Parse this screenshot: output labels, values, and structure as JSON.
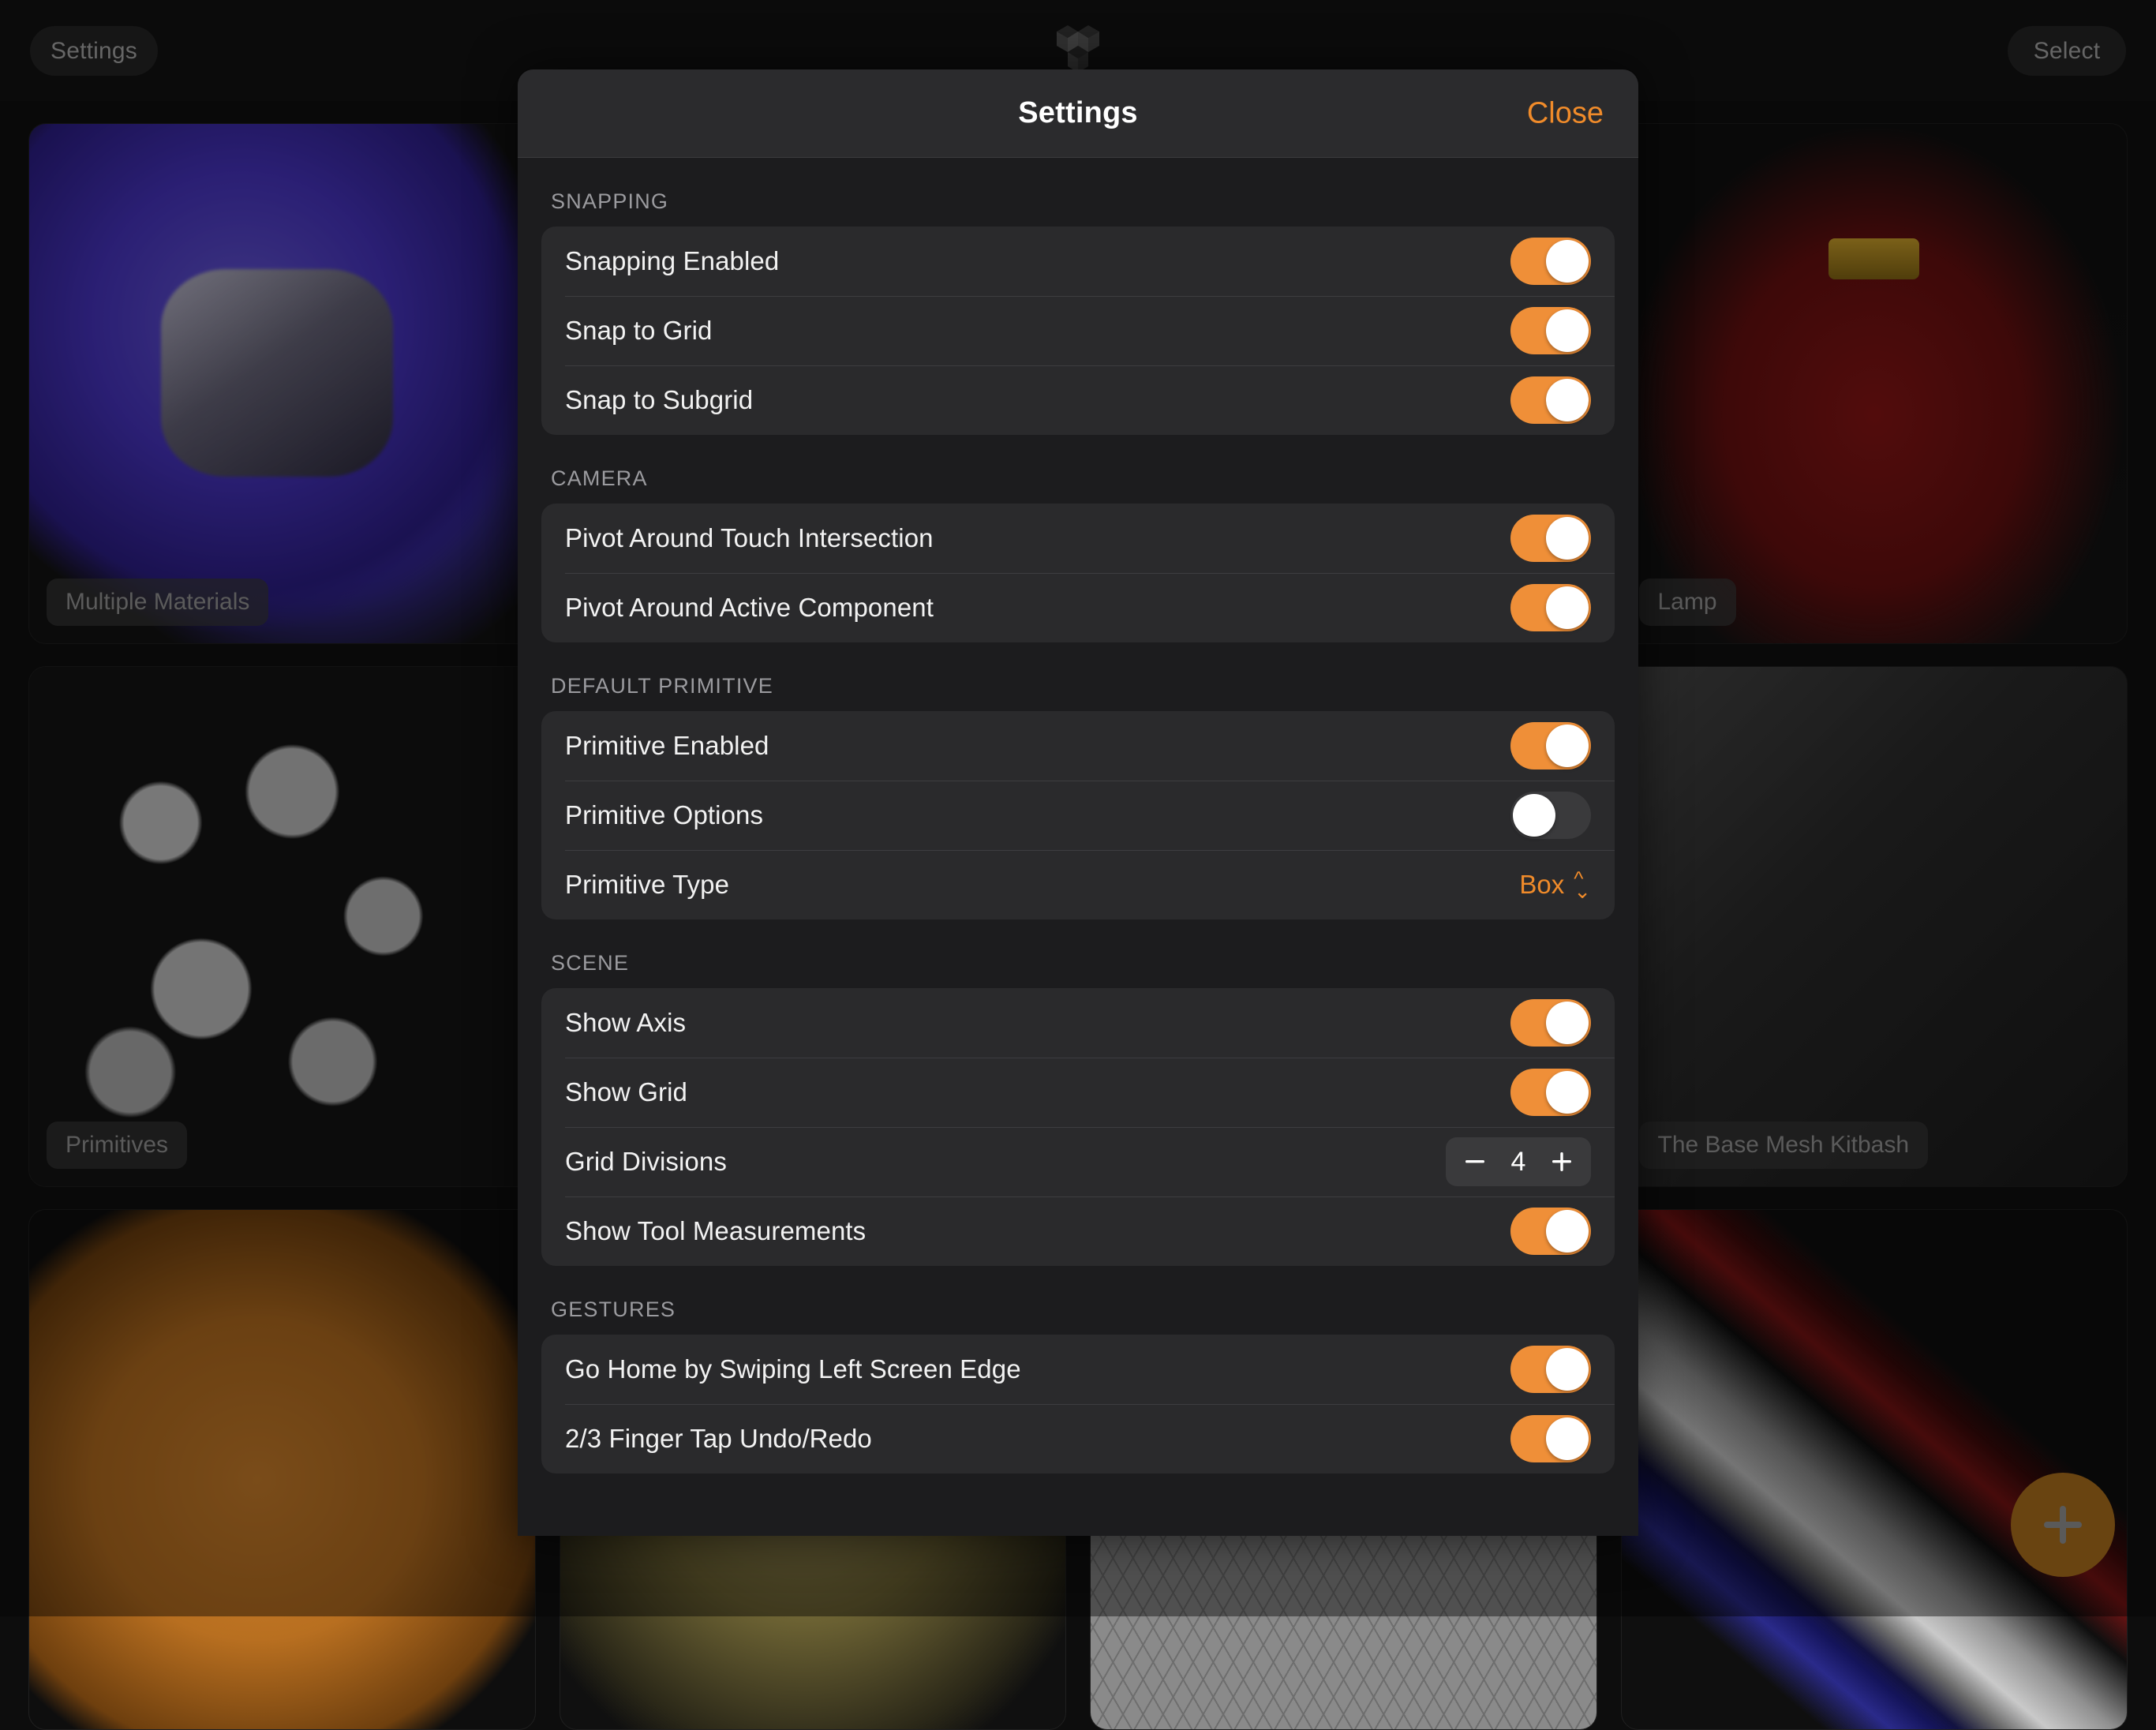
{
  "topbar": {
    "settings_label": "Settings",
    "select_label": "Select",
    "logo_name": "shapr3d-logo"
  },
  "gallery": {
    "items": [
      {
        "label": "Multiple Materials",
        "scene": "sc-multimat"
      },
      {
        "label": "",
        "scene": "sc-dark"
      },
      {
        "label": "",
        "scene": "sc-dark"
      },
      {
        "label": "Lamp",
        "scene": "sc-lamp"
      },
      {
        "label": "Primitives",
        "scene": "sc-prims"
      },
      {
        "label": "",
        "scene": "sc-dark"
      },
      {
        "label": "",
        "scene": "sc-dark"
      },
      {
        "label": "The Base Mesh Kitbash",
        "scene": "sc-kitbash"
      },
      {
        "label": "",
        "scene": "sc-blob"
      },
      {
        "label": "",
        "scene": "sc-olive"
      },
      {
        "label": "",
        "scene": "sc-wire"
      },
      {
        "label": "",
        "scene": "sc-rings"
      }
    ],
    "add_button_label": "+"
  },
  "modal": {
    "title": "Settings",
    "close_label": "Close",
    "sections": [
      {
        "title": "SNAPPING",
        "rows": [
          {
            "label": "Snapping Enabled",
            "control": "toggle",
            "value": "on"
          },
          {
            "label": "Snap to Grid",
            "control": "toggle",
            "value": "on"
          },
          {
            "label": "Snap to Subgrid",
            "control": "toggle",
            "value": "on"
          }
        ]
      },
      {
        "title": "CAMERA",
        "rows": [
          {
            "label": "Pivot Around Touch Intersection",
            "control": "toggle",
            "value": "on"
          },
          {
            "label": "Pivot Around Active Component",
            "control": "toggle",
            "value": "on"
          }
        ]
      },
      {
        "title": "DEFAULT PRIMITIVE",
        "rows": [
          {
            "label": "Primitive Enabled",
            "control": "toggle",
            "value": "on"
          },
          {
            "label": "Primitive Options",
            "control": "toggle",
            "value": "off"
          },
          {
            "label": "Primitive Type",
            "control": "picker",
            "value": "Box"
          }
        ]
      },
      {
        "title": "SCENE",
        "rows": [
          {
            "label": "Show Axis",
            "control": "toggle",
            "value": "on"
          },
          {
            "label": "Show Grid",
            "control": "toggle",
            "value": "on"
          },
          {
            "label": "Grid Divisions",
            "control": "stepper",
            "value": "4"
          },
          {
            "label": "Show Tool Measurements",
            "control": "toggle",
            "value": "on"
          }
        ]
      },
      {
        "title": "GESTURES",
        "rows": [
          {
            "label": "Go Home by Swiping Left Screen Edge",
            "control": "toggle",
            "value": "on"
          },
          {
            "label": "2/3 Finger Tap Undo/Redo",
            "control": "toggle",
            "value": "on"
          }
        ]
      }
    ]
  },
  "colors": {
    "accent": "#ef8f38",
    "accent_text": "#f08b2a",
    "toggle_off": "#3a3a3c",
    "modal_bg": "#1c1c1e",
    "card_bg": "#2a2a2c",
    "fab": "#b5761e"
  }
}
